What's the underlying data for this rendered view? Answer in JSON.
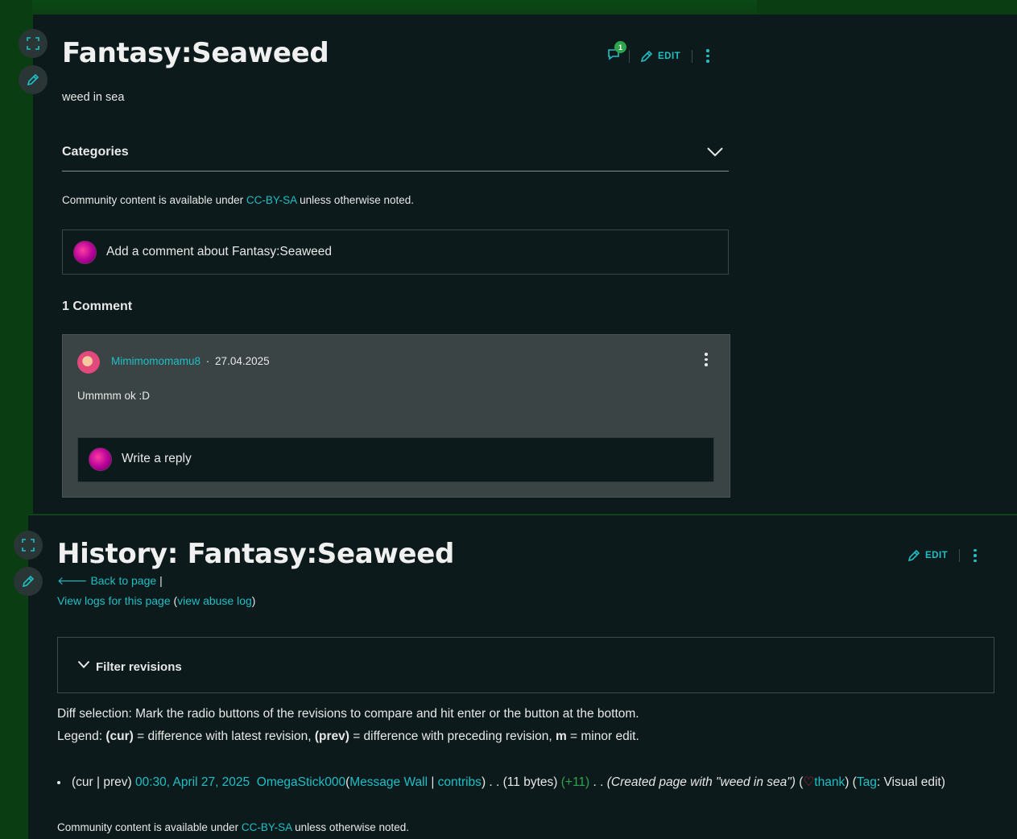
{
  "page1": {
    "title": "Fantasy:Seaweed",
    "comment_count_badge": "1",
    "edit_label": "EDIT",
    "content": "weed in sea",
    "categories_label": "Categories",
    "license": {
      "prefix": "Community content is available under ",
      "link": "CC-BY-SA",
      "suffix": " unless otherwise noted."
    },
    "add_comment_placeholder": "Add a comment about Fantasy:Seaweed",
    "comments_heading": "1 Comment",
    "comment": {
      "author": "Mimimomomamu8",
      "separator": "·",
      "date": "27.04.2025",
      "body": "Ummmm ok :D",
      "reply_placeholder": "Write a reply"
    }
  },
  "page2": {
    "title": "History: Fantasy:Seaweed",
    "edit_label": "EDIT",
    "back_to_page": "Back to page",
    "back_sep": "|",
    "view_logs": "View logs for this page",
    "view_abuse_log": "view abuse log",
    "filter_label": "Filter revisions",
    "diff_selection": "Diff selection: Mark the radio buttons of the revisions to compare and hit enter or the button at the bottom.",
    "legend": {
      "prefix": "Legend: ",
      "cur": "(cur)",
      "cur_desc": " = difference with latest revision, ",
      "prev": "(prev)",
      "prev_desc": " = difference with preceding revision, ",
      "m": "m",
      "m_desc": " = minor edit."
    },
    "revision": {
      "cur_prev": "(cur | prev)",
      "timestamp": "00:30, April 27, 2025",
      "user": "OmegaStick000",
      "message_wall": "Message Wall",
      "contribs": "contribs",
      "size": "(11 bytes)",
      "diff": "(+11)",
      "summary": "(Created page with \"weed in sea\")",
      "thank": "thank",
      "tag_label": "Tag",
      "tag_value": ": Visual edit)"
    },
    "license": {
      "prefix": "Community content is available under ",
      "link": "CC-BY-SA",
      "suffix": " unless otherwise noted."
    }
  },
  "colors": {
    "accent": "#1fbfc6",
    "panel_bg": "#0d1a1b",
    "page_bg": "#0b3d12",
    "badge": "#2ea44f"
  }
}
